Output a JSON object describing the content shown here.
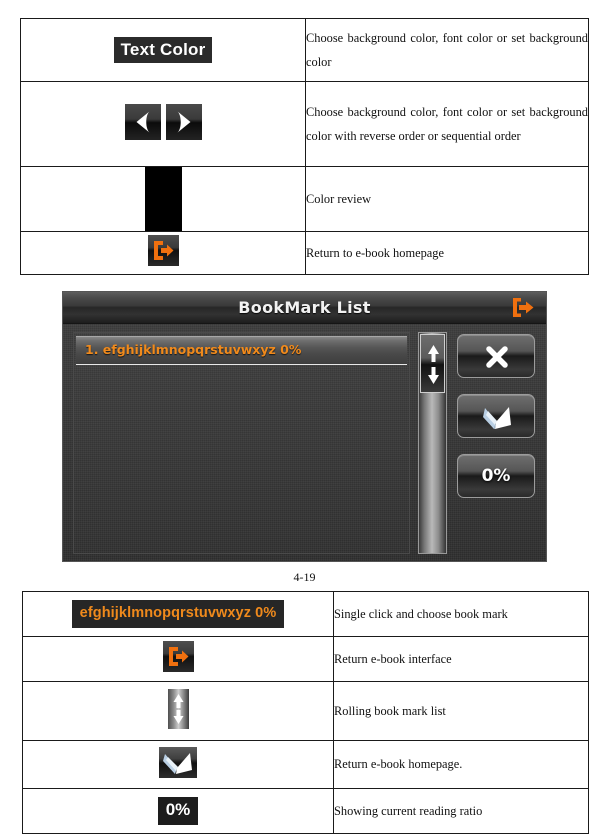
{
  "document": {
    "figure_caption": "4-19"
  },
  "table_top": {
    "rows": [
      {
        "icon_name": "text-color-button",
        "icon_label": "Text Color",
        "description": "Choose background color, font color or set  background color"
      },
      {
        "icon_name": "prev-next-arrows",
        "icon_label": "",
        "description": "Choose background color, font color or set background color with reverse order or sequential order"
      },
      {
        "icon_name": "color-preview-swatch",
        "icon_label": "",
        "description": "Color review"
      },
      {
        "icon_name": "return-home-icon",
        "icon_label": "",
        "description": "Return to e-book homepage"
      }
    ]
  },
  "device": {
    "title": "BookMark List",
    "exit_icon": "exit-icon",
    "list": {
      "items": [
        {
          "label": "1. efghijklmnopqrstuvwxyz 0%"
        }
      ]
    },
    "scrollbar": {
      "thumb_icon": "up-down-arrow-icon"
    },
    "buttons": [
      {
        "name": "close-button",
        "icon": "close-x-icon",
        "label": ""
      },
      {
        "name": "open-book-button",
        "icon": "open-book-icon",
        "label": ""
      },
      {
        "name": "reading-ratio-button",
        "icon": "",
        "label": "0%"
      }
    ]
  },
  "table_bottom": {
    "rows": [
      {
        "icon_name": "bookmark-entry",
        "icon_label": "efghijklmnopqrstuvwxyz 0%",
        "description": "Single click and choose book mark"
      },
      {
        "icon_name": "return-interface-icon",
        "icon_label": "",
        "description": "Return e-book interface"
      },
      {
        "icon_name": "scroll-list-icon",
        "icon_label": "",
        "description": "Rolling book mark list"
      },
      {
        "icon_name": "open-book-icon",
        "icon_label": "",
        "description": "Return e-book homepage."
      },
      {
        "icon_name": "reading-ratio-icon",
        "icon_label": "0%",
        "description": "Showing current reading ratio"
      }
    ]
  },
  "colors": {
    "accent_orange": "#f08a1c",
    "icon_dark": "#2b2b2b",
    "text": "#111111"
  }
}
